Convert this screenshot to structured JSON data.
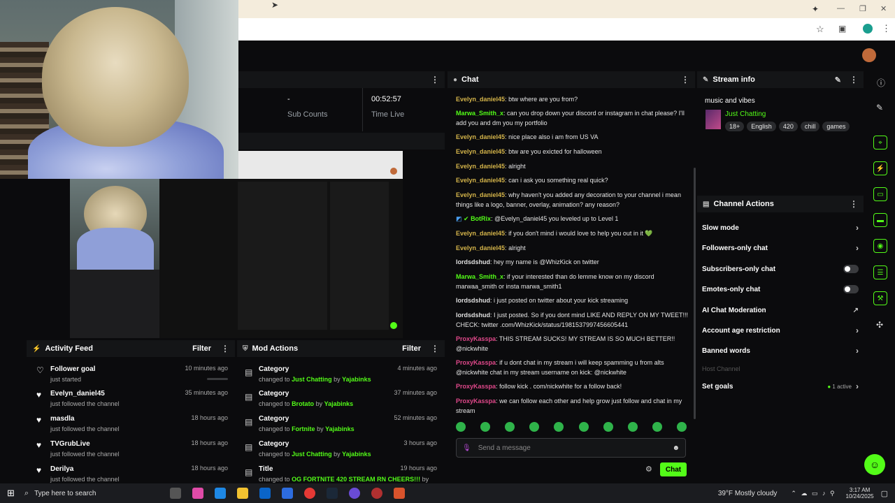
{
  "stats": {
    "sub_value": "-",
    "sub_label": "Sub Counts",
    "time_value": "00:52:57",
    "time_label": "Time Live"
  },
  "chat": {
    "title": "Chat",
    "messages": [
      {
        "user": "Evelyn_daniel45",
        "text": "btw where are you from?",
        "color": "o"
      },
      {
        "user": "Marwa_Smith_x",
        "text": "can you drop down your discord or instagram in chat please? I'll add you and dm you my portfolio",
        "color": "g"
      },
      {
        "user": "Evelyn_daniel45",
        "text": "nice place also i am from US VA",
        "color": "o"
      },
      {
        "user": "Evelyn_daniel45",
        "text": "btw are you exicted for halloween",
        "color": "o"
      },
      {
        "user": "Evelyn_daniel45",
        "text": "alright",
        "color": "o"
      },
      {
        "user": "Evelyn_daniel45",
        "text": "can i ask you something real quick?",
        "color": "o"
      },
      {
        "user": "Evelyn_daniel45",
        "text": "why haven't you added any decoration to your channel i mean things like a logo, banner, overlay, animation? any reason?",
        "color": "o"
      },
      {
        "user": "BotRix",
        "text": "@Evelyn_daniel45 you leveled up to Level 1",
        "color": "g"
      },
      {
        "user": "Evelyn_daniel45",
        "text": "if you don't mind i would love to help you out in it 💚",
        "color": "o"
      },
      {
        "user": "Evelyn_daniel45",
        "text": "alright",
        "color": "o"
      },
      {
        "user": "lordsdshud",
        "text": "hey my name is @WhizKick on twitter",
        "color": "gr"
      },
      {
        "user": "Marwa_Smith_x",
        "text": "if your interested than do lemme know on my discord marwaa_smith or insta marwa_smith1",
        "color": "g"
      },
      {
        "user": "lordsdshud",
        "text": "i just posted on twitter about your kick streaming",
        "color": "gr"
      },
      {
        "user": "lordsdshud",
        "text": "I just posted. So if you dont mind LIKE AND REPLY ON MY TWEET!!! CHECK: twitter .com/WhizKick/status/1981537997456605441",
        "color": "gr"
      },
      {
        "user": "ProxyKasspa",
        "text": "THIS STREAM SUCKS! MY STREAM IS SO MUCH BETTER!! @nickwhite",
        "color": "p"
      },
      {
        "user": "ProxyKasspa",
        "text": "if u dont chat in my stream i will keep spamming u from alts @nickwhite chat in my stream username on kick: @nickwhite",
        "color": "p"
      },
      {
        "user": "ProxyKasspa",
        "text": "follow kick . com/nickwhite for a follow back!",
        "color": "p"
      },
      {
        "user": "ProxyKasspa",
        "text": "we can follow each other and help grow just follow and chat in my stream",
        "color": "p"
      }
    ],
    "input_placeholder": "Send a message",
    "send_label": "Chat"
  },
  "stream_info": {
    "title": "Stream info",
    "stream_title": "music and vibes",
    "category": "Just Chatting",
    "tags": [
      "18+",
      "English",
      "420",
      "chill",
      "games"
    ]
  },
  "channel_actions": {
    "title": "Channel Actions",
    "items": [
      {
        "label": "Slow mode",
        "kind": "arrow"
      },
      {
        "label": "Followers-only chat",
        "kind": "arrow"
      },
      {
        "label": "Subscribers-only chat",
        "kind": "toggle"
      },
      {
        "label": "Emotes-only chat",
        "kind": "toggle"
      },
      {
        "label": "AI Chat Moderation",
        "kind": "ext"
      },
      {
        "label": "Account age restriction",
        "kind": "arrow"
      },
      {
        "label": "Banned words",
        "kind": "arrow"
      },
      {
        "label": "Host Channel",
        "kind": "disabled"
      },
      {
        "label": "Set goals",
        "kind": "goal",
        "extra": "1 active"
      }
    ]
  },
  "activity_feed": {
    "title": "Activity Feed",
    "filter": "Filter",
    "items": [
      {
        "title": "Follower goal",
        "sub": "just started",
        "time": "10 minutes ago"
      },
      {
        "title": "Evelyn_daniel45",
        "sub": "just followed the channel",
        "time": "35 minutes ago"
      },
      {
        "title": "masdla",
        "sub": "just followed the channel",
        "time": "18 hours ago"
      },
      {
        "title": "TVGrubLive",
        "sub": "just followed the channel",
        "time": "18 hours ago"
      },
      {
        "title": "Derilya",
        "sub": "just followed the channel",
        "time": "18 hours ago"
      }
    ]
  },
  "mod_actions": {
    "title": "Mod Actions",
    "filter": "Filter",
    "items": [
      {
        "title": "Category",
        "pre": "changed to",
        "target": "Just Chatting",
        "by": "by",
        "who": "Yajabinks",
        "time": "4 minutes ago"
      },
      {
        "title": "Category",
        "pre": "changed to",
        "target": "Brotato",
        "by": "by",
        "who": "Yajabinks",
        "time": "37 minutes ago"
      },
      {
        "title": "Category",
        "pre": "changed to",
        "target": "Fortnite",
        "by": "by",
        "who": "Yajabinks",
        "time": "52 minutes ago"
      },
      {
        "title": "Category",
        "pre": "changed to",
        "target": "Just Chatting",
        "by": "by",
        "who": "Yajabinks",
        "time": "3 hours ago"
      },
      {
        "title": "Title",
        "pre": "changed to",
        "target": "OG FORTNITE 420 STREAM RN CHEERS!!!",
        "by": "by",
        "who": "",
        "time": "19 hours ago"
      }
    ]
  },
  "taskbar": {
    "search_placeholder": "Type here to search",
    "weather": "39°F  Mostly cloudy",
    "time": "3:17 AM",
    "date": "10/24/2025"
  }
}
